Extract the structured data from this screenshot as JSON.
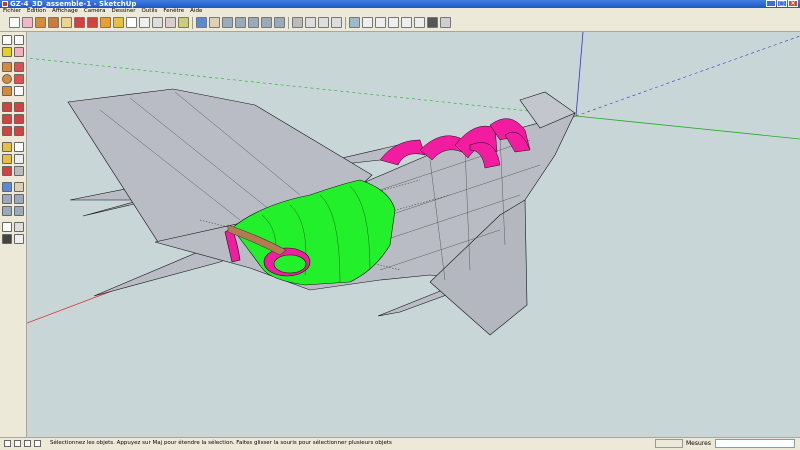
{
  "window": {
    "title": "GZ-4_3D_assemble-1 - SketchUp",
    "minimize": "_",
    "maximize": "□",
    "close": "×"
  },
  "menu": [
    "Fichier",
    "Edition",
    "Affichage",
    "Caméra",
    "Dessiner",
    "Outils",
    "Fenêtre",
    "Aide"
  ],
  "status": {
    "message": "Sélectionnez les objets. Appuyez sur Maj pour étendre la sélection. Faites glisser la souris pour sélectionner plusieurs objets",
    "measures_label": "Mesures",
    "measures_value": ""
  },
  "colors": {
    "viewport_bg": "#c9d6d8",
    "model_gray": "#b9bcc4",
    "highlight_green": "#22f02a",
    "highlight_pink": "#f21ca0",
    "axis_red": "#d33",
    "axis_green": "#2a2",
    "axis_blue": "#33c"
  },
  "toolbar_icons": [
    "select-icon",
    "eraser-icon",
    "rectangle-icon",
    "push-pull-icon",
    "move-icon",
    "rotate-icon",
    "paint-icon",
    "tape-icon",
    "orbit-icon",
    "pan-icon",
    "zoom-icon",
    "zoom-extents-icon",
    "iso-view-icon",
    "top-view-icon",
    "front-view-icon",
    "right-view-icon",
    "back-view-icon",
    "left-view-icon",
    "xray-icon",
    "wireframe-icon",
    "hidden-line-icon",
    "shaded-icon",
    "textured-icon",
    "monochrome-icon"
  ]
}
